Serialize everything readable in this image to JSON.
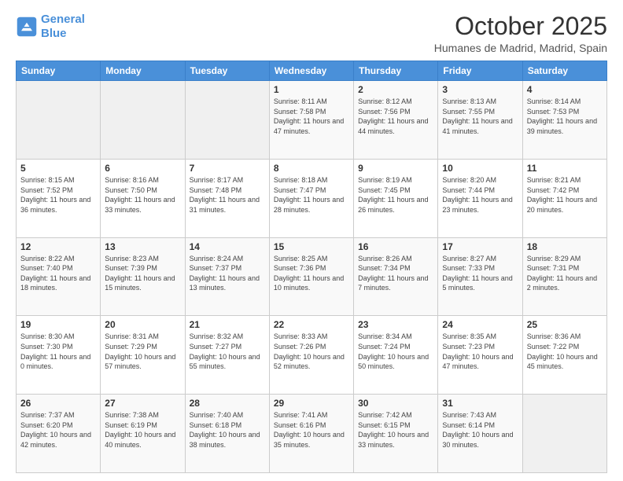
{
  "header": {
    "logo_line1": "General",
    "logo_line2": "Blue",
    "month": "October 2025",
    "location": "Humanes de Madrid, Madrid, Spain"
  },
  "days_of_week": [
    "Sunday",
    "Monday",
    "Tuesday",
    "Wednesday",
    "Thursday",
    "Friday",
    "Saturday"
  ],
  "weeks": [
    [
      {
        "day": "",
        "info": ""
      },
      {
        "day": "",
        "info": ""
      },
      {
        "day": "",
        "info": ""
      },
      {
        "day": "1",
        "info": "Sunrise: 8:11 AM\nSunset: 7:58 PM\nDaylight: 11 hours and 47 minutes."
      },
      {
        "day": "2",
        "info": "Sunrise: 8:12 AM\nSunset: 7:56 PM\nDaylight: 11 hours and 44 minutes."
      },
      {
        "day": "3",
        "info": "Sunrise: 8:13 AM\nSunset: 7:55 PM\nDaylight: 11 hours and 41 minutes."
      },
      {
        "day": "4",
        "info": "Sunrise: 8:14 AM\nSunset: 7:53 PM\nDaylight: 11 hours and 39 minutes."
      }
    ],
    [
      {
        "day": "5",
        "info": "Sunrise: 8:15 AM\nSunset: 7:52 PM\nDaylight: 11 hours and 36 minutes."
      },
      {
        "day": "6",
        "info": "Sunrise: 8:16 AM\nSunset: 7:50 PM\nDaylight: 11 hours and 33 minutes."
      },
      {
        "day": "7",
        "info": "Sunrise: 8:17 AM\nSunset: 7:48 PM\nDaylight: 11 hours and 31 minutes."
      },
      {
        "day": "8",
        "info": "Sunrise: 8:18 AM\nSunset: 7:47 PM\nDaylight: 11 hours and 28 minutes."
      },
      {
        "day": "9",
        "info": "Sunrise: 8:19 AM\nSunset: 7:45 PM\nDaylight: 11 hours and 26 minutes."
      },
      {
        "day": "10",
        "info": "Sunrise: 8:20 AM\nSunset: 7:44 PM\nDaylight: 11 hours and 23 minutes."
      },
      {
        "day": "11",
        "info": "Sunrise: 8:21 AM\nSunset: 7:42 PM\nDaylight: 11 hours and 20 minutes."
      }
    ],
    [
      {
        "day": "12",
        "info": "Sunrise: 8:22 AM\nSunset: 7:40 PM\nDaylight: 11 hours and 18 minutes."
      },
      {
        "day": "13",
        "info": "Sunrise: 8:23 AM\nSunset: 7:39 PM\nDaylight: 11 hours and 15 minutes."
      },
      {
        "day": "14",
        "info": "Sunrise: 8:24 AM\nSunset: 7:37 PM\nDaylight: 11 hours and 13 minutes."
      },
      {
        "day": "15",
        "info": "Sunrise: 8:25 AM\nSunset: 7:36 PM\nDaylight: 11 hours and 10 minutes."
      },
      {
        "day": "16",
        "info": "Sunrise: 8:26 AM\nSunset: 7:34 PM\nDaylight: 11 hours and 7 minutes."
      },
      {
        "day": "17",
        "info": "Sunrise: 8:27 AM\nSunset: 7:33 PM\nDaylight: 11 hours and 5 minutes."
      },
      {
        "day": "18",
        "info": "Sunrise: 8:29 AM\nSunset: 7:31 PM\nDaylight: 11 hours and 2 minutes."
      }
    ],
    [
      {
        "day": "19",
        "info": "Sunrise: 8:30 AM\nSunset: 7:30 PM\nDaylight: 11 hours and 0 minutes."
      },
      {
        "day": "20",
        "info": "Sunrise: 8:31 AM\nSunset: 7:29 PM\nDaylight: 10 hours and 57 minutes."
      },
      {
        "day": "21",
        "info": "Sunrise: 8:32 AM\nSunset: 7:27 PM\nDaylight: 10 hours and 55 minutes."
      },
      {
        "day": "22",
        "info": "Sunrise: 8:33 AM\nSunset: 7:26 PM\nDaylight: 10 hours and 52 minutes."
      },
      {
        "day": "23",
        "info": "Sunrise: 8:34 AM\nSunset: 7:24 PM\nDaylight: 10 hours and 50 minutes."
      },
      {
        "day": "24",
        "info": "Sunrise: 8:35 AM\nSunset: 7:23 PM\nDaylight: 10 hours and 47 minutes."
      },
      {
        "day": "25",
        "info": "Sunrise: 8:36 AM\nSunset: 7:22 PM\nDaylight: 10 hours and 45 minutes."
      }
    ],
    [
      {
        "day": "26",
        "info": "Sunrise: 7:37 AM\nSunset: 6:20 PM\nDaylight: 10 hours and 42 minutes."
      },
      {
        "day": "27",
        "info": "Sunrise: 7:38 AM\nSunset: 6:19 PM\nDaylight: 10 hours and 40 minutes."
      },
      {
        "day": "28",
        "info": "Sunrise: 7:40 AM\nSunset: 6:18 PM\nDaylight: 10 hours and 38 minutes."
      },
      {
        "day": "29",
        "info": "Sunrise: 7:41 AM\nSunset: 6:16 PM\nDaylight: 10 hours and 35 minutes."
      },
      {
        "day": "30",
        "info": "Sunrise: 7:42 AM\nSunset: 6:15 PM\nDaylight: 10 hours and 33 minutes."
      },
      {
        "day": "31",
        "info": "Sunrise: 7:43 AM\nSunset: 6:14 PM\nDaylight: 10 hours and 30 minutes."
      },
      {
        "day": "",
        "info": ""
      }
    ]
  ]
}
